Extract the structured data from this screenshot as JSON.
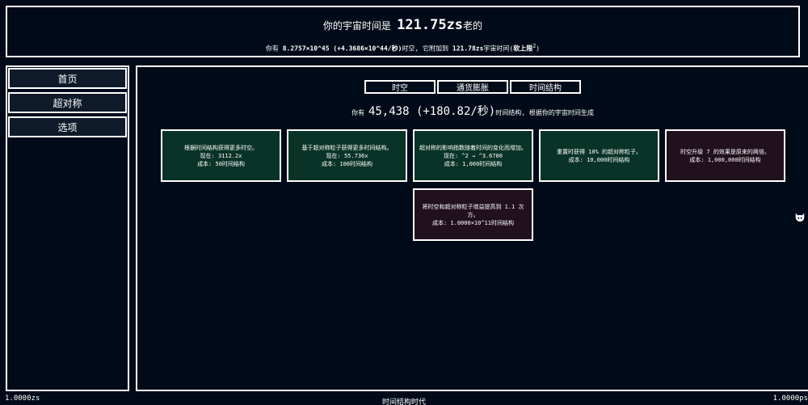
{
  "header": {
    "age_prefix": "你的宇宙时间是 ",
    "age_value": "121.75zs",
    "age_suffix": "老的",
    "spacetime_prefix": "你有 ",
    "spacetime_amount": "8.2757×10^45",
    "spacetime_rate": " (+4.3686×10^44/秒)",
    "spacetime_mid": "时空, 它附加到 ",
    "spacetime_total": "121.78zs",
    "spacetime_suffix": "宇宙时间(",
    "softcap_label": "软上限",
    "softcap_sup": "2",
    "spacetime_close": ")"
  },
  "sidebar": {
    "items": [
      {
        "label": "首页"
      },
      {
        "label": "超对称"
      },
      {
        "label": "选项"
      }
    ]
  },
  "tabs": [
    {
      "label": "时空"
    },
    {
      "label": "通货膨胀"
    },
    {
      "label": "时间结构"
    }
  ],
  "generation": {
    "prefix": "你有 ",
    "amount": "45,438",
    "rate": " (+180.82/秒)",
    "suffix": "时间结构, 根据你的宇宙时间生成"
  },
  "upgrades": [
    {
      "desc": "根据时间结构获得更多时空。",
      "current": "现在:  3112.2x",
      "cost": "成本:  50时间结构",
      "color": "green"
    },
    {
      "desc": "基于超对称粒子获得更多时间结构。",
      "current": "现在:  55.736x",
      "cost": "成本:  100时间结构",
      "color": "green"
    },
    {
      "desc": "超对称的影响指数随着时间的变化而增加。",
      "current": "现在:  ^2 → ^3.6700",
      "cost": "成本:  1,000时间结构",
      "color": "green"
    },
    {
      "desc": "重置时获得 10% 的超对称粒子。",
      "current": "",
      "cost": "成本:  10,000时间结构",
      "color": "green"
    },
    {
      "desc": "时空升级 7 的效果是原来的两倍。",
      "current": "",
      "cost": "成本:  1,000,000时间结构",
      "color": "plum"
    },
    {
      "desc": "将时空和超对称粒子增益提高到 1.1 次方。",
      "current": "",
      "cost": "成本:  1.0000×10^11时间结构",
      "color": "plum"
    }
  ],
  "icons": {
    "github": "github-cat-icon"
  },
  "footer": {
    "left": "1.0000zs",
    "center": "时间结构时代",
    "right": "1.0000ps"
  },
  "colors": {
    "background": "#010a18",
    "affordable": "#093327",
    "locked": "#21101d",
    "border": "#ffffff"
  }
}
